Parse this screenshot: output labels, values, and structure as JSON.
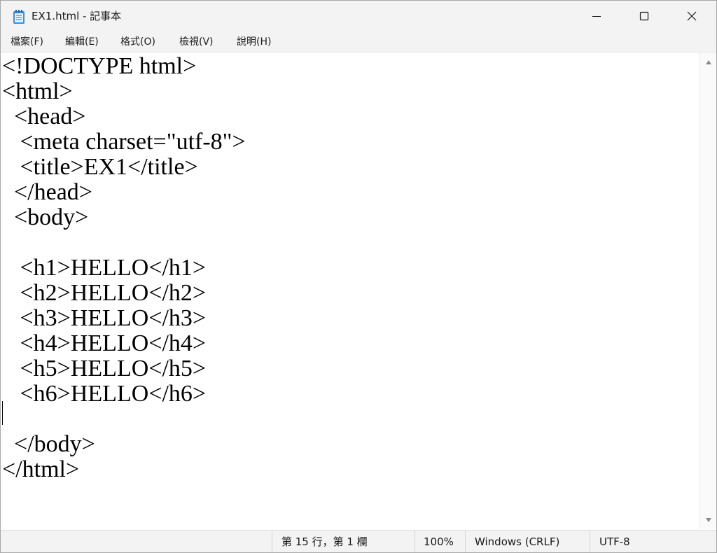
{
  "window": {
    "title": "EX1.html - 記事本",
    "controls": {
      "minimize": "minimize",
      "maximize": "maximize",
      "close": "close"
    }
  },
  "menu": {
    "items": [
      "檔案(F)",
      "編輯(E)",
      "格式(O)",
      "檢視(V)",
      "說明(H)"
    ]
  },
  "editor": {
    "lines": [
      "<!DOCTYPE html>",
      "<html>",
      "  <head>",
      "   <meta charset=\"utf-8\">",
      "   <title>EX1</title>",
      "  </head>",
      "  <body>",
      "",
      "   <h1>HELLO</h1>",
      "   <h2>HELLO</h2>",
      "   <h3>HELLO</h3>",
      "   <h4>HELLO</h4>",
      "   <h5>HELLO</h5>",
      "   <h6>HELLO</h6>",
      "",
      "  </body>",
      "</html>"
    ]
  },
  "status": {
    "position": "第 15 行，第 1 欄",
    "zoom": "100%",
    "line_ending": "Windows (CRLF)",
    "encoding": "UTF-8"
  },
  "colors": {
    "chrome": "#f3f3f3",
    "text": "#000000",
    "icon_accent": "#2b7bd8"
  }
}
